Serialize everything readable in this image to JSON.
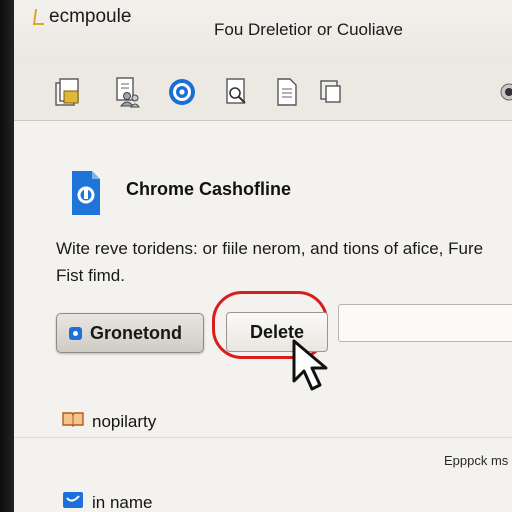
{
  "app": {
    "name": "ecmpoule",
    "window_title": "Fou Dreletior or Cuoliave"
  },
  "toolbar": {
    "icons": [
      "folder-doc-icon",
      "users-doc-icon",
      "target-icon",
      "edit-doc-icon",
      "document-icon",
      "copy-icon",
      "more-icon"
    ]
  },
  "main": {
    "title": "Chrome Cashofline",
    "description": "Wite reve toridens: or fiile nerom, and tions of afice, Fure Fist fimd.",
    "primary_button_label": "Gronetond",
    "delete_button_label": "Delete",
    "text_field_value": "",
    "colors": {
      "accent": "#1e6fd9",
      "highlight": "#d81d1d"
    }
  },
  "list": {
    "items": [
      {
        "label": "nopilarty",
        "icon": "book-icon"
      },
      {
        "label": "in name",
        "icon": "bird-icon"
      }
    ],
    "side_label": "Epppck ms"
  }
}
